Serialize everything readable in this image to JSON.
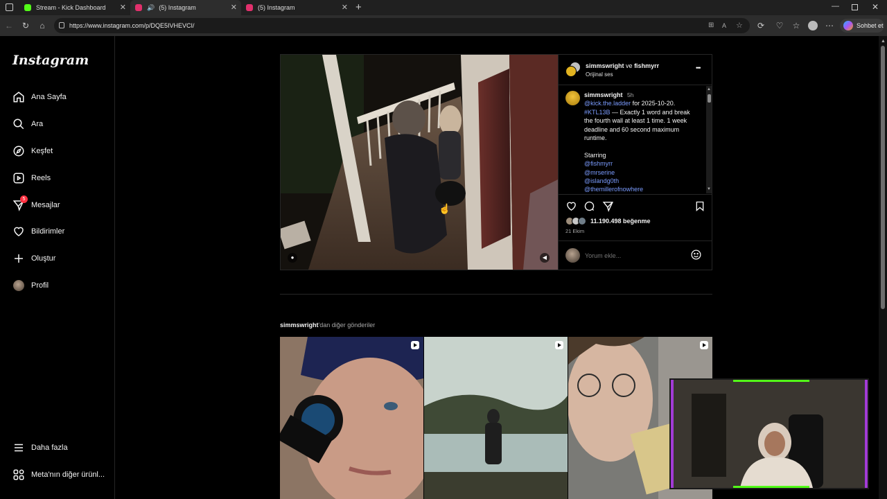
{
  "browser": {
    "tabs": [
      {
        "label": "Stream - Kick Dashboard",
        "favicon_color": "#53fc18"
      },
      {
        "label": "(5) Instagram",
        "favicon_color": "#e1306c"
      },
      {
        "label": "(5) Instagram",
        "favicon_color": "#e1306c"
      }
    ],
    "url": "https://www.instagram.com/p/DQE5IVHEVCI/",
    "copilot_label": "Sohbet et"
  },
  "sidebar": {
    "logo": "Instagram",
    "items": [
      {
        "label": "Ana Sayfa",
        "icon": "home-icon"
      },
      {
        "label": "Ara",
        "icon": "search-icon"
      },
      {
        "label": "Keşfet",
        "icon": "compass-icon"
      },
      {
        "label": "Reels",
        "icon": "reels-icon"
      },
      {
        "label": "Mesajlar",
        "icon": "messenger-icon",
        "badge": "5"
      },
      {
        "label": "Bildirimler",
        "icon": "heart-icon"
      },
      {
        "label": "Oluştur",
        "icon": "plus-icon"
      },
      {
        "label": "Profil",
        "icon": "avatar-icon"
      }
    ],
    "bottom": [
      {
        "label": "Daha fazla",
        "icon": "menu-icon"
      },
      {
        "label": "Meta'nın diğer ürünl...",
        "icon": "meta-apps-icon"
      }
    ]
  },
  "post": {
    "header": {
      "author": "simmswright",
      "connector": "ve",
      "coauthor": "fishmyrr",
      "audio": "Orijinal ses",
      "more": "•••"
    },
    "caption": {
      "author": "simmswright",
      "time": "5h",
      "mention": "@kick.the.ladder",
      "text1": " for 2025-10-20.",
      "hashtag": "#KTL13B",
      "text2": " — Exactly 1 word and break the fourth wall at least 1 time. 1 week deadline and 60 second maximum runtime.",
      "starring_label": "Starring",
      "starring": [
        "@fishmyrr",
        "@mrserine",
        "@islandg0th",
        "@themillerofnowhere"
      ]
    },
    "likes": "11.190.498 beğenme",
    "date": "21 Ekim",
    "comment_placeholder": "Yorum ekle..."
  },
  "more_posts": {
    "user": "simmswright",
    "suffix": "'dan diğer gönderiler"
  }
}
